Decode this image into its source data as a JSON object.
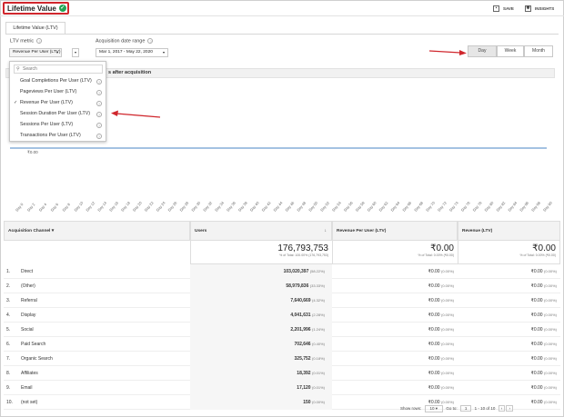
{
  "header": {
    "title": "Lifetime Value",
    "save_label": "SAVE",
    "insights_label": "INSIGHTS",
    "check_icon": "check-circle-icon",
    "save_icon": "floppy-disk-icon",
    "insights_icon": "insights-icon"
  },
  "tab": "Lifetime Value (LTV)",
  "controls": {
    "metric_label": "LTV metric",
    "metric_value": "Revenue Per User (LTV)",
    "range_label": "Acquisition date range",
    "range_value": "Mar 1, 2017 - May 22, 2020",
    "granularity": [
      "Day",
      "Week",
      "Month"
    ],
    "active_granularity": "Day"
  },
  "chart": {
    "header_text": "s after acquisition",
    "y_label": "₹0.00",
    "x_ticks": [
      "Day 0",
      "Day 2",
      "Day 4",
      "Day 6",
      "Day 8",
      "Day 10",
      "Day 12",
      "Day 14",
      "Day 16",
      "Day 18",
      "Day 20",
      "Day 22",
      "Day 24",
      "Day 26",
      "Day 28",
      "Day 30",
      "Day 32",
      "Day 34",
      "Day 36",
      "Day 38",
      "Day 40",
      "Day 42",
      "Day 44",
      "Day 46",
      "Day 48",
      "Day 50",
      "Day 52",
      "Day 54",
      "Day 56",
      "Day 58",
      "Day 60",
      "Day 62",
      "Day 64",
      "Day 66",
      "Day 68",
      "Day 70",
      "Day 72",
      "Day 74",
      "Day 76",
      "Day 78",
      "Day 80",
      "Day 82",
      "Day 84",
      "Day 86",
      "Day 88",
      "Day 90"
    ],
    "line_color": "#4a86c5"
  },
  "dropdown": {
    "search_placeholder": "Search",
    "items": [
      "Goal Completions Per User (LTV)",
      "Pageviews Per User (LTV)",
      "Revenue Per User (LTV)",
      "Session Duration Per User (LTV)",
      "Sessions Per User (LTV)",
      "Transactions Per User (LTV)"
    ],
    "selected_index": 2
  },
  "table": {
    "headers": [
      "Acquisition Channel",
      "Users",
      "Revenue Per User (LTV)",
      "Revenue (LTV)"
    ],
    "totals": {
      "users": "176,793,753",
      "users_sub": "% of Total: 100.00% (176,793,753)",
      "rpu": "₹0.00",
      "rpu_sub": "% of Total: 0.00% (₹0.00)",
      "rev": "₹0.00",
      "rev_sub": "% of Total: 0.00% (₹0.00)"
    },
    "rows": [
      {
        "n": "1.",
        "name": "Direct",
        "users": "103,020,397",
        "pct": "(58.22%)",
        "rpu": "₹0.00",
        "rpu_pct": "(0.00%)",
        "rev": "₹0.00",
        "rev_pct": "(0.00%)"
      },
      {
        "n": "2.",
        "name": "(Other)",
        "users": "58,979,836",
        "pct": "(33.33%)",
        "rpu": "₹0.00",
        "rpu_pct": "(0.00%)",
        "rev": "₹0.00",
        "rev_pct": "(0.00%)"
      },
      {
        "n": "3.",
        "name": "Referral",
        "users": "7,640,669",
        "pct": "(4.32%)",
        "rpu": "₹0.00",
        "rpu_pct": "(0.00%)",
        "rev": "₹0.00",
        "rev_pct": "(0.00%)"
      },
      {
        "n": "4.",
        "name": "Display",
        "users": "4,041,631",
        "pct": "(2.28%)",
        "rpu": "₹0.00",
        "rpu_pct": "(0.00%)",
        "rev": "₹0.00",
        "rev_pct": "(0.00%)"
      },
      {
        "n": "5.",
        "name": "Social",
        "users": "2,201,996",
        "pct": "(1.24%)",
        "rpu": "₹0.00",
        "rpu_pct": "(0.00%)",
        "rev": "₹0.00",
        "rev_pct": "(0.00%)"
      },
      {
        "n": "6.",
        "name": "Paid Search",
        "users": "702,646",
        "pct": "(0.40%)",
        "rpu": "₹0.00",
        "rpu_pct": "(0.00%)",
        "rev": "₹0.00",
        "rev_pct": "(0.00%)"
      },
      {
        "n": "7.",
        "name": "Organic Search",
        "users": "325,752",
        "pct": "(0.18%)",
        "rpu": "₹0.00",
        "rpu_pct": "(0.00%)",
        "rev": "₹0.00",
        "rev_pct": "(0.00%)"
      },
      {
        "n": "8.",
        "name": "Affiliates",
        "users": "18,392",
        "pct": "(0.01%)",
        "rpu": "₹0.00",
        "rpu_pct": "(0.00%)",
        "rev": "₹0.00",
        "rev_pct": "(0.00%)"
      },
      {
        "n": "9.",
        "name": "Email",
        "users": "17,120",
        "pct": "(0.01%)",
        "rpu": "₹0.00",
        "rpu_pct": "(0.00%)",
        "rev": "₹0.00",
        "rev_pct": "(0.00%)"
      },
      {
        "n": "10.",
        "name": "(not set)",
        "users": "150",
        "pct": "(0.00%)",
        "rpu": "₹0.00",
        "rpu_pct": "(0.00%)",
        "rev": "₹0.00",
        "rev_pct": "(0.00%)"
      }
    ]
  },
  "footer": {
    "show_rows_label": "Show rows:",
    "show_rows_value": "10",
    "goto_label": "Go to:",
    "goto_value": "1",
    "pagination": "1 - 10 of 10"
  }
}
